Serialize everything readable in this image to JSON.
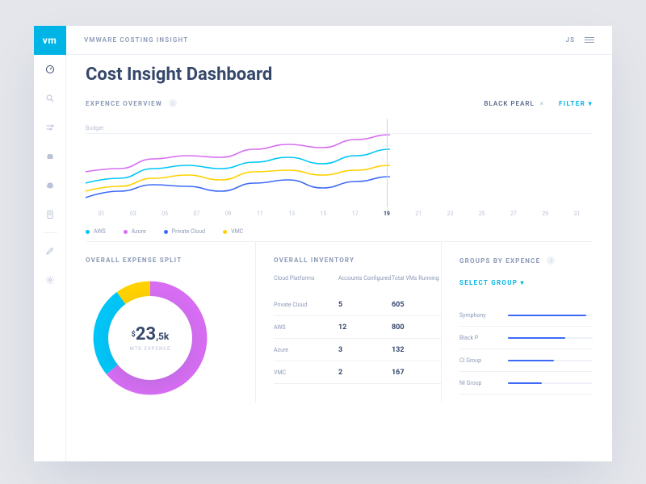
{
  "brand": "VMWARE COSTING INSIGHT",
  "user_initials": "JS",
  "page_title": "Cost Insight Dashboard",
  "overview": {
    "title": "EXPENCE OVERVIEW",
    "active_chip": "BLACK PEARL",
    "filter_label": "FILTER ▾",
    "budget_label": "Budget",
    "xticks": [
      "01",
      "03",
      "05",
      "07",
      "09",
      "11",
      "13",
      "15",
      "17",
      "19",
      "21",
      "23",
      "25",
      "27",
      "29",
      "31"
    ],
    "active_tick_index": 9,
    "legend": [
      {
        "label": "AWS",
        "color": "#00c6f7"
      },
      {
        "label": "Azure",
        "color": "#d76df2"
      },
      {
        "label": "Private Cloud",
        "color": "#3c6af6"
      },
      {
        "label": "VMC",
        "color": "#ffd100"
      }
    ]
  },
  "split": {
    "title": "OVERALL EXPENSE SPLIT",
    "amount_currency": "$",
    "amount_major": "23",
    "amount_minor": ",5k",
    "amount_label": "MTD EXPENCE"
  },
  "inventory": {
    "title": "OVERALL INVENTORY",
    "col_a": "Cloud Platforms",
    "col_b": "Accounts Configured",
    "col_c": "Total VMs Running",
    "rows": [
      {
        "a": "Private Cloud",
        "b": "5",
        "c": "605"
      },
      {
        "a": "AWS",
        "b": "12",
        "c": "800"
      },
      {
        "a": "Azure",
        "b": "3",
        "c": "132"
      },
      {
        "a": "VMC",
        "b": "2",
        "c": "167"
      }
    ]
  },
  "groups": {
    "title": "GROUPS BY EXPENCE",
    "select_label": "SELECT GROUP ▾",
    "rows": [
      {
        "label": "Symphony",
        "pct": 92
      },
      {
        "label": "Black P",
        "pct": 68
      },
      {
        "label": "CI Group",
        "pct": 54
      },
      {
        "label": "NI Group",
        "pct": 40
      }
    ]
  },
  "chart_data": [
    {
      "type": "line",
      "title": "Expence Overview",
      "x": [
        1,
        3,
        5,
        7,
        9,
        11,
        13,
        15,
        17,
        19
      ],
      "xlim": [
        1,
        31
      ],
      "budget": 100,
      "series": [
        {
          "name": "AWS",
          "color": "#00c6f7",
          "values": [
            40,
            46,
            58,
            62,
            58,
            66,
            72,
            64,
            74,
            82
          ]
        },
        {
          "name": "Azure",
          "color": "#d76df2",
          "values": [
            54,
            58,
            70,
            74,
            72,
            82,
            88,
            84,
            94,
            100
          ]
        },
        {
          "name": "Private Cloud",
          "color": "#3c6af6",
          "values": [
            22,
            30,
            38,
            36,
            30,
            40,
            44,
            34,
            42,
            48
          ]
        },
        {
          "name": "VMC",
          "color": "#ffd100",
          "values": [
            30,
            36,
            46,
            50,
            44,
            54,
            56,
            50,
            56,
            62
          ]
        }
      ],
      "ylabel": "",
      "xlabel": ""
    },
    {
      "type": "pie",
      "title": "Overall Expense Split",
      "series": [
        {
          "name": "Magenta",
          "color": "#d76df2",
          "value": 64
        },
        {
          "name": "Cyan",
          "color": "#00c6f7",
          "value": 26
        },
        {
          "name": "Yellow",
          "color": "#ffd100",
          "value": 10
        }
      ],
      "center_label": "$23,5k MTD Expence"
    }
  ]
}
